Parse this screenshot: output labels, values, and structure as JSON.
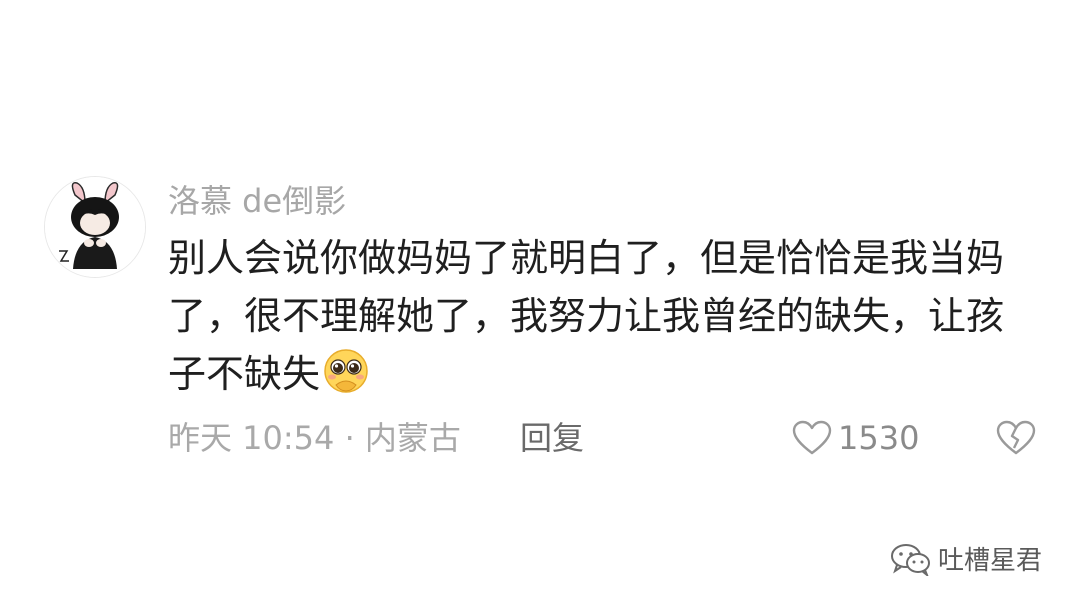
{
  "comment": {
    "author": "洛慕 de倒影",
    "text": "别人会说你做妈妈了就明白了，但是恰恰是我当妈了，很不理解她了，我努力让我曾经的缺失，让孩子不缺失",
    "emoji": "pleading-face-emoji",
    "meta": "昨天 10:54 · 内蒙古",
    "reply_label": "回复",
    "like_count": "1530"
  },
  "watermark": {
    "text": "吐槽星君",
    "icon": "wechat-icon"
  },
  "colors": {
    "background": "#ffffff",
    "author": "#a7a7a7",
    "text": "#1f1f1f",
    "meta": "#a9a9a9",
    "reply": "#6a6a6a"
  }
}
